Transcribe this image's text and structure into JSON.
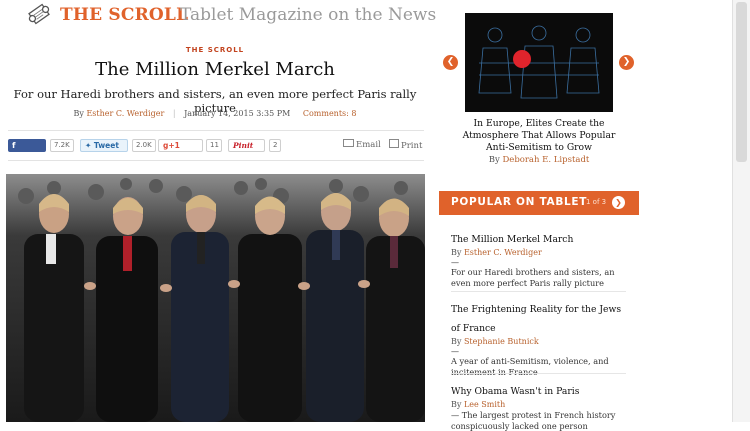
{
  "header": {
    "title": "THE SCROLL",
    "subtitle": "Tablet Magazine on the News"
  },
  "article": {
    "kicker": "THE SCROLL",
    "headline": "The Million Merkel March",
    "dek": "For our Haredi brothers and sisters, an even more perfect Paris rally picture",
    "by_prefix": "By",
    "author": "Esther C. Werdiger",
    "date": "January 14, 2015 3:35 PM",
    "comments": "Comments: 8"
  },
  "share": {
    "facebook_label": "Share",
    "facebook_count": "7.2K",
    "twitter_label": "Tweet",
    "twitter_count": "2.0K",
    "gplus_label": "g+1",
    "gplus_count": "11",
    "pinterest_label": "Pinit",
    "pinterest_count": "2",
    "email_label": "Email",
    "print_label": "Print"
  },
  "carousel": {
    "caption": "In Europe, Elites Create the Atmosphere That Allows Popular Anti-Semitism to Grow",
    "by_prefix": "By",
    "author": "Deborah E. Lipstadt",
    "prev_icon": "chevron-left-icon",
    "next_icon": "chevron-right-icon"
  },
  "popular": {
    "title": "POPULAR ON TABLET",
    "pager": "1 of 3",
    "items": [
      {
        "title": "The Million Merkel March",
        "by_prefix": "By",
        "author": "Esther C. Werdiger",
        "dash": "—",
        "desc": "For our Haredi brothers and sisters, an even more perfect Paris rally picture"
      },
      {
        "title": "The Frightening Reality for the Jews of France",
        "by_prefix": "By",
        "author": "Stephanie Butnick",
        "dash": "—",
        "desc": "A year of anti-Semitism, violence, and incitement in France"
      },
      {
        "title": "Why Obama Wasn't in Paris",
        "by_prefix": "By",
        "author": "Lee Smith",
        "dash": "—",
        "desc": "The largest protest in French history conspicuously lacked one person"
      }
    ]
  },
  "colors": {
    "accent": "#e0622b",
    "link": "#b8622e",
    "facebook": "#3b5998"
  }
}
